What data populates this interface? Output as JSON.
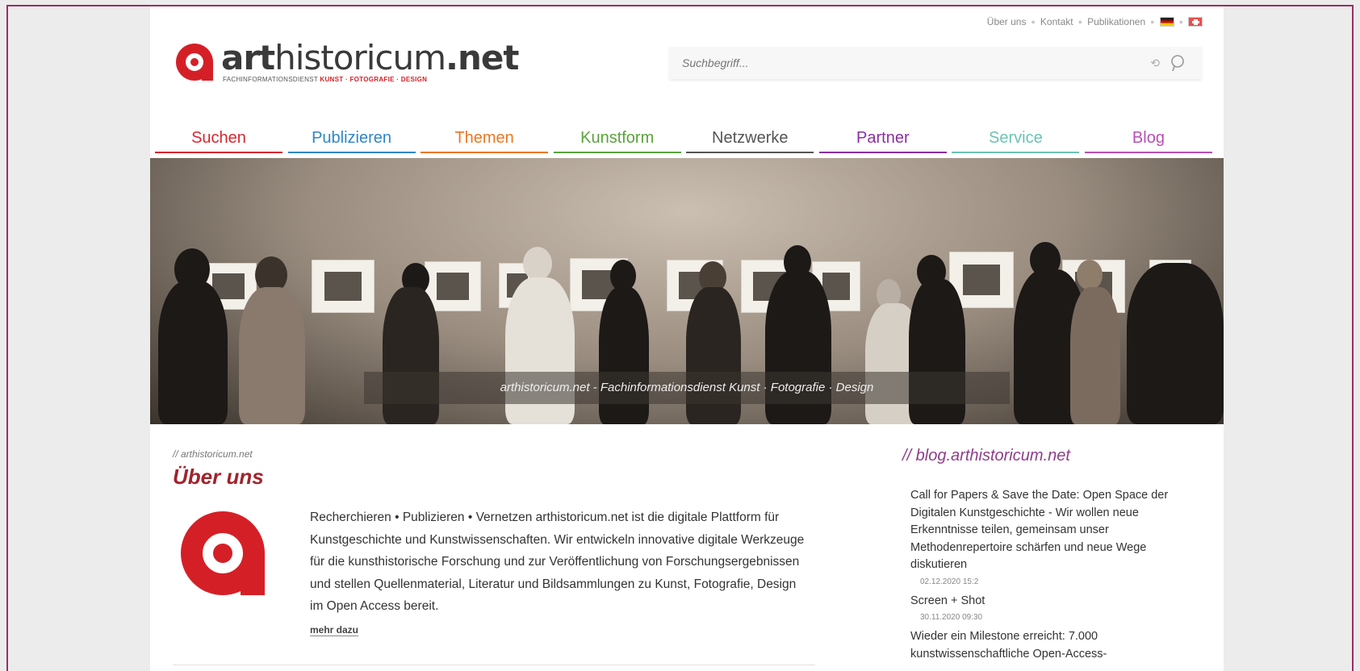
{
  "toplinks": {
    "about": "Über uns",
    "contact": "Kontakt",
    "publications": "Publikationen",
    "sep": "●"
  },
  "logo": {
    "brand_bold": "art",
    "brand_thin": "historicum",
    "brand_tld": ".net",
    "sub_prefix": "FACHINFORMATIONSDIENST ",
    "sub_accent": "KUNST · FOTOGRAFIE · DESIGN"
  },
  "search": {
    "placeholder": "Suchbegriff..."
  },
  "nav": [
    {
      "label": "Suchen",
      "color": "#d8262f"
    },
    {
      "label": "Publizieren",
      "color": "#2f86c9"
    },
    {
      "label": "Themen",
      "color": "#ee7623"
    },
    {
      "label": "Kunstform",
      "color": "#5aa33c"
    },
    {
      "label": "Netzwerke",
      "color": "#555555"
    },
    {
      "label": "Partner",
      "color": "#8b2ea3"
    },
    {
      "label": "Service",
      "color": "#6cc3b5"
    },
    {
      "label": "Blog",
      "color": "#b94fb5"
    }
  ],
  "hero": {
    "caption": "arthistoricum.net - Fachinformationsdienst Kunst · Fotografie · Design"
  },
  "about": {
    "crumb": "// arthistoricum.net",
    "title": "Über uns",
    "text": "Recherchieren • Publizieren • Vernetzen arthistoricum.net ist die digitale Plattform für Kunstgeschichte und Kunstwissenschaften. Wir entwickeln innovative digitale Werkzeuge für die kunsthistorische Forschung und zur Veröffentlichung von Forschungsergebnissen und stellen Quellenmaterial, Literatur und Bildsammlungen zu Kunst, Fotografie, Design im Open Access bereit.",
    "more": "mehr dazu"
  },
  "blog": {
    "head": "// blog.arthistoricum.net",
    "items": [
      {
        "title": "Call for Papers & Save the Date: Open Space der Digitalen Kunstgeschichte - Wir wollen neue Erkenntnisse teilen, gemeinsam unser Methodenrepertoire schärfen und neue Wege diskutieren",
        "date": "02.12.2020 15:2"
      },
      {
        "title": "Screen + Shot",
        "date": "30.11.2020 09:30"
      },
      {
        "title": "Wieder ein Milestone erreicht: 7.000 kunstwissenschaftliche Open-Access-",
        "date": ""
      }
    ]
  }
}
